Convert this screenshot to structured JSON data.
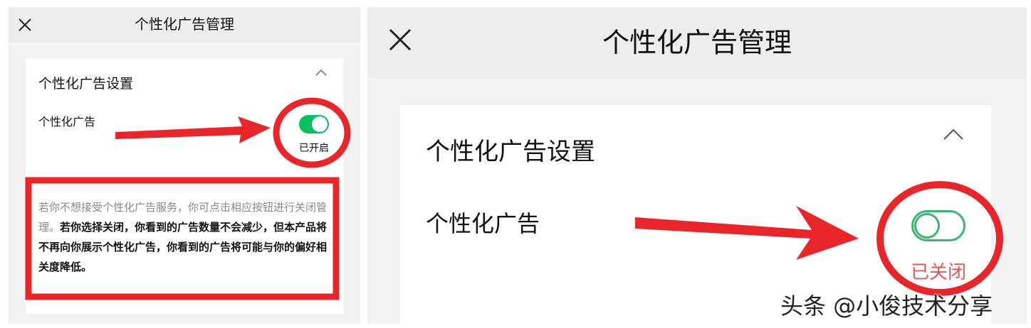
{
  "left": {
    "title": "个性化广告管理",
    "section_title": "个性化广告设置",
    "row_label": "个性化广告",
    "toggle_on": true,
    "status": "已开启",
    "description_plain": "若你不想接受个性化广告服务，你可点击相应按钮进行关闭管理。",
    "description_bold": "若你选择关闭，你看到的广告数量不会减少，但本产品将不再向你展示个性化广告，你看到的广告将可能与你的偏好相关度降低。"
  },
  "right": {
    "title": "个性化广告管理",
    "section_title": "个性化广告设置",
    "row_label": "个性化广告",
    "toggle_on": false,
    "status": "已关闭"
  },
  "watermark": "头条 @小俊技术分享",
  "colors": {
    "toggle_on": "#07c160",
    "toggle_off_border": "#3cb371",
    "status_off": "#e25555",
    "annotation": "#e8262a"
  },
  "icons": [
    "close-icon",
    "chevron-up-icon",
    "arrow-annotation"
  ]
}
